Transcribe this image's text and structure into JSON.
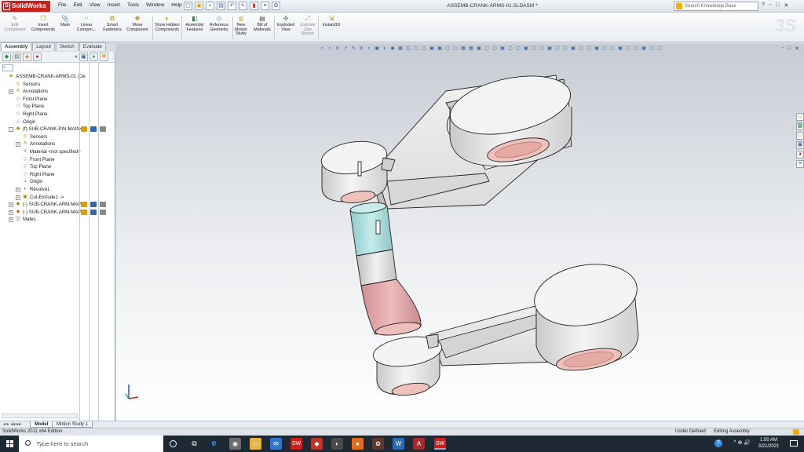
{
  "app": {
    "name": "SolidWorks",
    "document_title": "ASSEMB-CRANK-ARMS-01.SLDASM *",
    "menu": [
      "File",
      "Edit",
      "View",
      "Insert",
      "Tools",
      "Window",
      "Help"
    ],
    "search_placeholder": "Search Knowledge Base",
    "help_icons": [
      "?",
      "-",
      "□",
      "✕"
    ]
  },
  "command_manager": {
    "buttons": [
      {
        "label": "Edit Component",
        "icon": "edit-component-icon",
        "enabled": false
      },
      {
        "label": "Insert Components",
        "icon": "insert-components-icon",
        "enabled": true
      },
      {
        "label": "Mate",
        "icon": "mate-icon",
        "enabled": true
      },
      {
        "label": "Linear Compon...",
        "icon": "linear-pattern-icon",
        "enabled": true
      },
      {
        "label": "Smart Fasteners",
        "icon": "smart-fasteners-icon",
        "enabled": true
      },
      {
        "label": "Move Component",
        "icon": "move-component-icon",
        "enabled": true
      },
      {
        "label": "Show Hidden Components",
        "icon": "show-hidden-icon",
        "enabled": true
      },
      {
        "label": "Assembly Features",
        "icon": "assembly-features-icon",
        "enabled": true
      },
      {
        "label": "Reference Geometry",
        "icon": "reference-geometry-icon",
        "enabled": true
      },
      {
        "label": "New Motion Study",
        "icon": "motion-study-icon",
        "enabled": true
      },
      {
        "label": "Bill of Materials",
        "icon": "bom-icon",
        "enabled": true
      },
      {
        "label": "Exploded View",
        "icon": "exploded-view-icon",
        "enabled": true
      },
      {
        "label": "Explode Line Sketch",
        "icon": "explode-line-icon",
        "enabled": false
      },
      {
        "label": "Instant3D",
        "icon": "instant3d-icon",
        "enabled": true
      }
    ]
  },
  "command_tabs": [
    "Assembly",
    "Layout",
    "Sketch",
    "Evaluate"
  ],
  "feature_tree": {
    "items": [
      {
        "label": "ASSEMB-CRANK-ARMS-01  (De",
        "icon": "assembly-icon",
        "indent": 0,
        "expander": ""
      },
      {
        "label": "Sensors",
        "icon": "sensors-icon",
        "indent": 1,
        "expander": ""
      },
      {
        "label": "Annotations",
        "icon": "annotations-icon",
        "indent": 1,
        "expander": "+"
      },
      {
        "label": "Front Plane",
        "icon": "plane-icon",
        "indent": 1,
        "expander": ""
      },
      {
        "label": "Top Plane",
        "icon": "plane-icon",
        "indent": 1,
        "expander": ""
      },
      {
        "label": "Right Plane",
        "icon": "plane-icon",
        "indent": 1,
        "expander": ""
      },
      {
        "label": "Origin",
        "icon": "origin-icon",
        "indent": 1,
        "expander": ""
      },
      {
        "label": "(f) SUB-CRANK-PIN-MAIN<",
        "icon": "part-icon",
        "indent": 1,
        "expander": "-"
      },
      {
        "label": "Sensors",
        "icon": "sensors-icon",
        "indent": 2,
        "expander": ""
      },
      {
        "label": "Annotations",
        "icon": "annotations-icon",
        "indent": 2,
        "expander": "+"
      },
      {
        "label": "Material <not specified>",
        "icon": "material-icon",
        "indent": 2,
        "expander": ""
      },
      {
        "label": "Front Plane",
        "icon": "plane-icon",
        "indent": 2,
        "expander": ""
      },
      {
        "label": "Top Plane",
        "icon": "plane-icon",
        "indent": 2,
        "expander": ""
      },
      {
        "label": "Right Plane",
        "icon": "plane-icon",
        "indent": 2,
        "expander": ""
      },
      {
        "label": "Origin",
        "icon": "origin-icon",
        "indent": 2,
        "expander": ""
      },
      {
        "label": "Revolve1",
        "icon": "revolve-icon",
        "indent": 2,
        "expander": "+"
      },
      {
        "label": "Cut-Extrude1 ->",
        "icon": "cut-extrude-icon",
        "indent": 2,
        "expander": "+"
      },
      {
        "label": "(-) SUB-CRANK-ARM-MAIN",
        "icon": "part-icon",
        "indent": 1,
        "expander": "+"
      },
      {
        "label": "(-) SUB-CRANK-ARM-MAIN",
        "icon": "part-icon",
        "indent": 1,
        "expander": "+"
      },
      {
        "label": "Mates",
        "icon": "mates-icon",
        "indent": 1,
        "expander": "+"
      }
    ]
  },
  "sheet_tabs": [
    "Model",
    "Motion Study 1"
  ],
  "status": {
    "left": "SolidWorks 2011 x64 Edition",
    "state": "Under Defined",
    "mode": "Editing Assembly"
  },
  "taskbar": {
    "search_placeholder": "Type here to search",
    "time": "1:50 AM",
    "date": "3/21/2021"
  },
  "viewport": {
    "window_controls": [
      "-",
      "□",
      "✕"
    ]
  },
  "colors": {
    "solidworks_red": "#c8201c",
    "part_grey": "#e9e9e9",
    "pin_cyan": "#a9d8d8",
    "pin_pink": "#e3a8aa",
    "bore_pink": "#f0c0bb",
    "taskbar": "#1f2933"
  }
}
